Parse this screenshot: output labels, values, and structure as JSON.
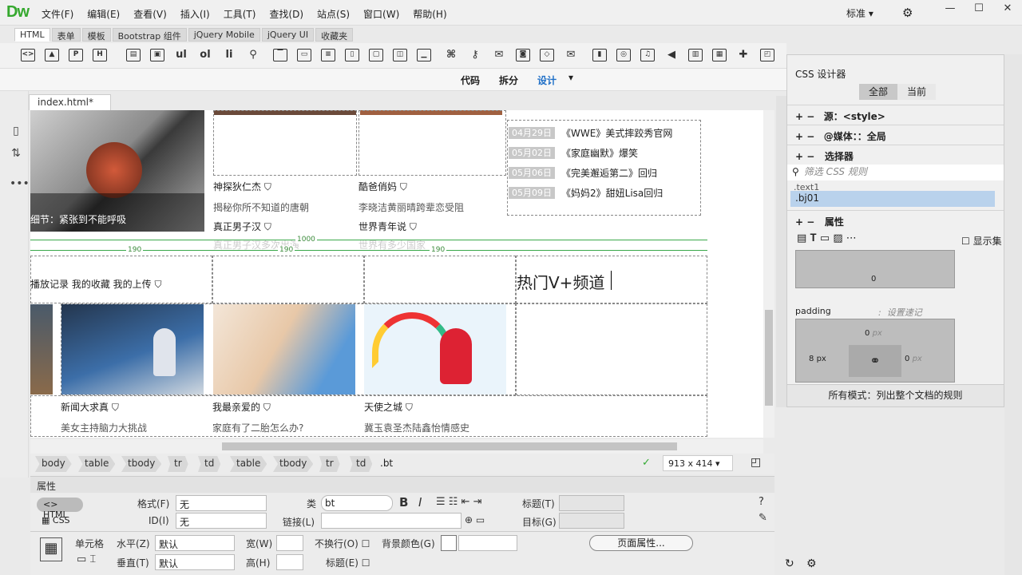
{
  "app": {
    "logo": "Dw",
    "menus": [
      "文件(F)",
      "编辑(E)",
      "查看(V)",
      "插入(I)",
      "工具(T)",
      "查找(D)",
      "站点(S)",
      "窗口(W)",
      "帮助(H)"
    ],
    "workspace": "标准 ▾",
    "window_controls": [
      "—",
      "☐",
      "✕"
    ]
  },
  "insert_tabs": [
    "HTML",
    "表单",
    "模板",
    "Bootstrap 组件",
    "jQuery Mobile",
    "jQuery UI",
    "收藏夹"
  ],
  "insert_text_buttons": [
    "ul",
    "ol",
    "li"
  ],
  "view": {
    "code": "代码",
    "split": "拆分",
    "design": "设计"
  },
  "doc": {
    "tab": "index.html*",
    "close": "✕"
  },
  "page": {
    "top_caption": "细节：紧张到不能呼吸",
    "items_row1": [
      {
        "title": "神探狄仁杰",
        "sub": "揭秘你所不知道的唐朝"
      },
      {
        "title": "酷爸俏妈",
        "sub": "李晓洁黄丽晴跨辈恋受阻"
      }
    ],
    "items_row2": [
      {
        "title": "真正男子汉",
        "sub": "真正男子汉多次出演"
      },
      {
        "title": "世界青年说",
        "sub": "世界有多少国家"
      }
    ],
    "news": [
      {
        "date": "04月29日",
        "title": "《WWE》美式摔跤秀官网"
      },
      {
        "date": "05月02日",
        "title": "《家庭幽默》爆笑"
      },
      {
        "date": "05月06日",
        "title": "《完美邂逅第二》回归"
      },
      {
        "date": "05月09日",
        "title": "《妈妈2》甜妞Lisa回归"
      }
    ],
    "width_total": "1000",
    "col_widths": [
      "190",
      "190",
      "190"
    ],
    "nav_links": "播放记录   我的收藏   我的上传",
    "hot_title": "热门V+频道",
    "items_row3": [
      {
        "title": "新闻大求真",
        "sub": "美女主持脑力大挑战"
      },
      {
        "title": "我最亲爱的",
        "sub": "家庭有了二胎怎么办?"
      },
      {
        "title": "天使之城",
        "sub": "冀玉袁圣杰陆鑫怡情感史"
      }
    ]
  },
  "tagbar": {
    "tags": [
      "body",
      "table",
      "tbody",
      "tr",
      "td",
      "table",
      "tbody",
      "tr",
      "td"
    ],
    "current": ".bt",
    "size": "913 x 414"
  },
  "props": {
    "title": "属性",
    "html_btn": "HTML",
    "css_btn": "CSS",
    "format_label": "格式(F)",
    "format_value": "无",
    "id_label": "ID(I)",
    "id_value": "无",
    "class_label": "类",
    "class_value": "bt",
    "link_label": "链接(L)",
    "heading_label": "标题(T)",
    "target_label": "目标(G)",
    "cell_label": "单元格",
    "horz_label": "水平(Z)",
    "horz_value": "默认",
    "vert_label": "垂直(T)",
    "vert_value": "默认",
    "width_label": "宽(W)",
    "height_label": "高(H)",
    "nowrap_label": "不换行(O)",
    "header_label": "标题(E)",
    "bg_label": "背景颜色(G)",
    "page_props": "页面属性..."
  },
  "css_designer": {
    "title": "CSS 设计器",
    "all": "全部",
    "current": "当前",
    "source_label": "源：",
    "source_value": "<style>",
    "media_label": "@媒体：：",
    "media_value": "全局",
    "selectors_label": "选择器",
    "filter_placeholder": "筛选 CSS 规则",
    "selectors": [
      ".text1",
      ".bj01"
    ],
    "properties_label": "属性",
    "show_set": "显示集",
    "margin_bottom": "0",
    "padding_label": "padding",
    "padding_hint": "设置速记",
    "padding_top": "0",
    "padding_left": "8",
    "padding_right": "0",
    "unit": "px",
    "footer": "所有模式：列出整个文档的规则"
  }
}
